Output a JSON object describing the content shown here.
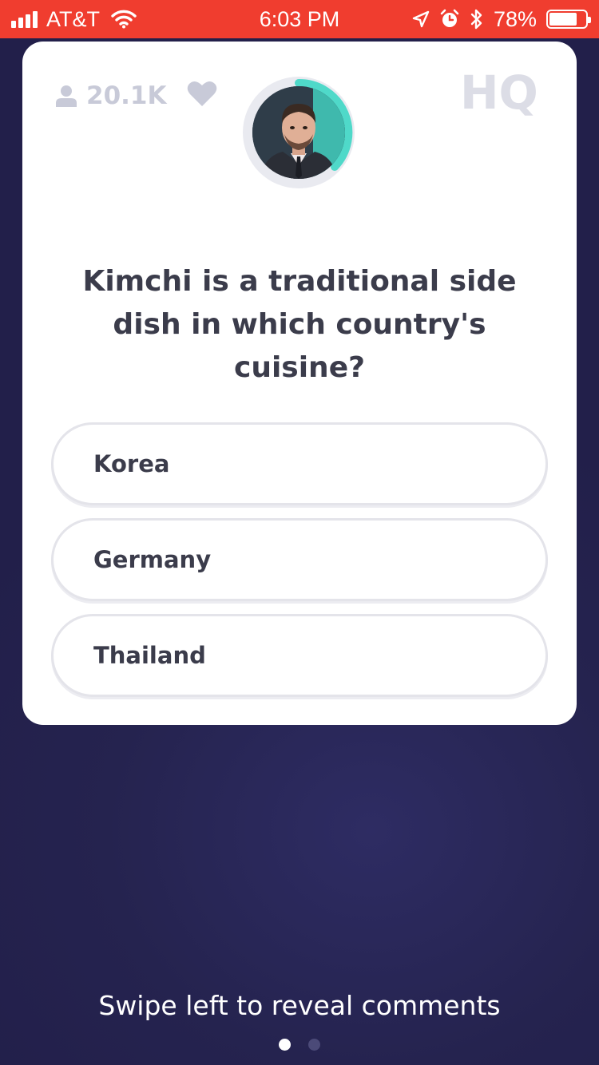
{
  "status_bar": {
    "carrier": "AT&T",
    "time": "6:03 PM",
    "battery": "78%",
    "battery_level": 0.78
  },
  "header": {
    "viewer_count": "20.1K",
    "logo_text": "HQ"
  },
  "question": {
    "text": "Kimchi is a traditional side dish in which country's cuisine?"
  },
  "answers": [
    {
      "label": "Korea"
    },
    {
      "label": "Germany"
    },
    {
      "label": "Thailand"
    }
  ],
  "footer": {
    "hint": "Swipe left to reveal comments",
    "pages": 2,
    "active_page": 1
  },
  "colors": {
    "status_bar": "#f03d2f",
    "background": "#25234f",
    "timer_arc": "#4fd9c9",
    "muted_gray": "#c8cad8",
    "text_dark": "#3b3c4b"
  },
  "icons": [
    "cellular-signal-icon",
    "wifi-icon",
    "location-arrow-icon",
    "alarm-icon",
    "bluetooth-icon",
    "battery-icon",
    "person-icon",
    "heart-icon"
  ]
}
